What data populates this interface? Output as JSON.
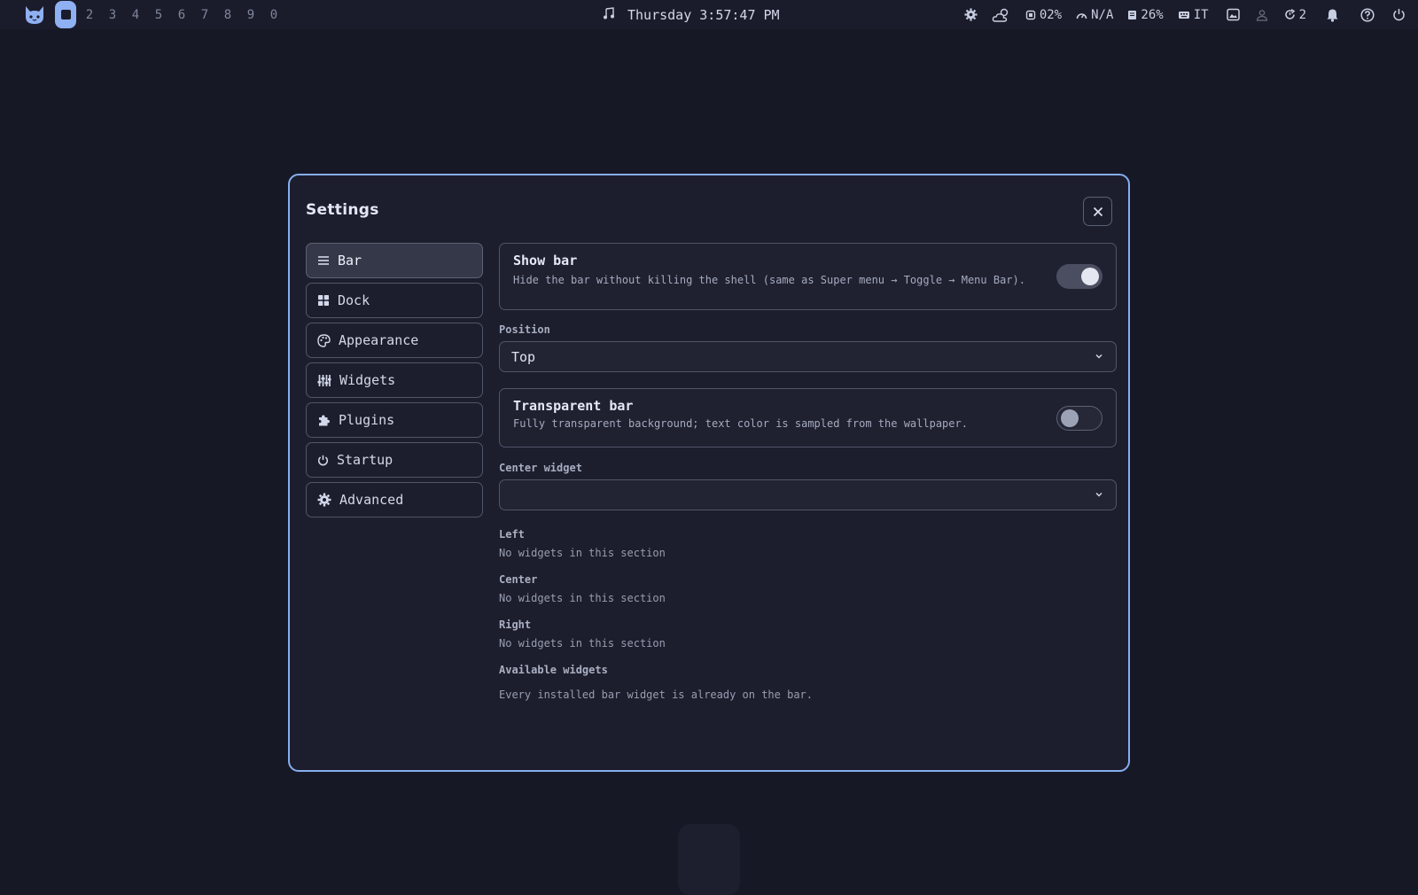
{
  "topbar": {
    "workspaces": [
      "2",
      "3",
      "4",
      "5",
      "6",
      "7",
      "8",
      "9",
      "0"
    ],
    "clock": "Thursday 3:57:47 PM",
    "cpu": "02%",
    "network": "N/A",
    "memory": "26%",
    "keyboard_layout": "IT",
    "updates": "2"
  },
  "settings": {
    "title": "Settings",
    "nav": [
      {
        "label": "Bar"
      },
      {
        "label": "Dock"
      },
      {
        "label": "Appearance"
      },
      {
        "label": "Widgets"
      },
      {
        "label": "Plugins"
      },
      {
        "label": "Startup"
      },
      {
        "label": "Advanced"
      }
    ],
    "show_bar": {
      "title": "Show bar",
      "description": "Hide the bar without killing the shell (same as Super menu → Toggle → Menu Bar).",
      "enabled": true
    },
    "position": {
      "label": "Position",
      "value": "Top"
    },
    "transparent_bar": {
      "title": "Transparent bar",
      "description": "Fully transparent background; text color is sampled from the wallpaper.",
      "enabled": false
    },
    "center_widget": {
      "label": "Center widget",
      "value": ""
    },
    "sections": [
      {
        "label": "Left",
        "empty": "No widgets in this section"
      },
      {
        "label": "Center",
        "empty": "No widgets in this section"
      },
      {
        "label": "Right",
        "empty": "No widgets in this section"
      }
    ],
    "available": {
      "label": "Available widgets",
      "note": "Every installed bar widget is already on the bar."
    }
  },
  "colors": {
    "accent": "#86aef0",
    "background": "#171826",
    "panel": "#1d1e2d"
  }
}
